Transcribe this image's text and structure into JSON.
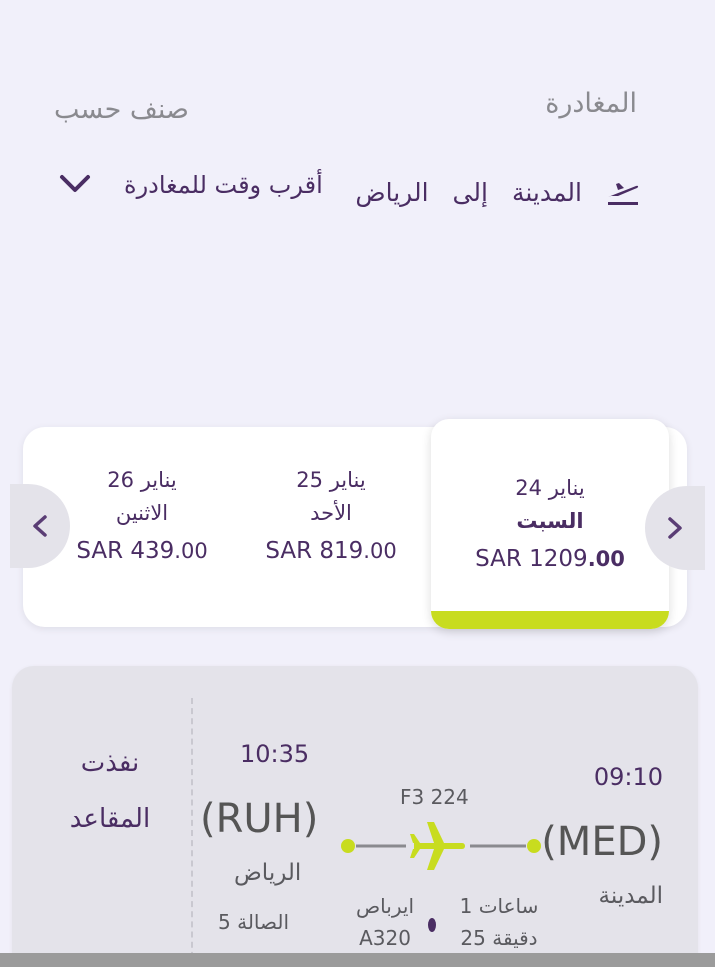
{
  "header": {
    "departure_label": "المغادرة",
    "sort_label": "صنف حسب",
    "origin": "المدينة",
    "to_word": "إلى",
    "destination": "الرياض",
    "sort_value": "أقرب وقت للمغادرة",
    "departure_icon": "plane-departure-icon",
    "sort_icon": "chevron-down-icon"
  },
  "date_strip": {
    "prev_icon": "chevron-left-icon",
    "next_icon": "chevron-right-icon",
    "accent_color": "#c8dc1f",
    "days": [
      {
        "date": "24 يناير",
        "weekday": "السبت",
        "currency": "SAR",
        "price_int": "1209",
        "price_frac": ".00",
        "selected": true
      },
      {
        "date": "25 يناير",
        "weekday": "الأحد",
        "currency": "SAR",
        "price_int": "819",
        "price_frac": ".00",
        "selected": false
      },
      {
        "date": "26 يناير",
        "weekday": "الاثنين",
        "currency": "SAR",
        "price_int": "439",
        "price_frac": ".00",
        "selected": false
      }
    ]
  },
  "flight": {
    "departure_time": "09:10",
    "departure_code": "(MED)",
    "departure_city": "المدينة",
    "arrival_time": "10:35",
    "arrival_code": "(RUH)",
    "arrival_city": "الرياض",
    "terminal": "الصالة  5",
    "flight_number": "F3 224",
    "duration_hours": "1 ساعات",
    "duration_minutes": "25 دقيقة",
    "aircraft_maker": "ايرباص",
    "aircraft_model": "A320",
    "status_line1": "نفذت",
    "status_line2": "المقاعد",
    "plane_icon": "airplane-icon",
    "plane_color": "#c8dc1f"
  }
}
